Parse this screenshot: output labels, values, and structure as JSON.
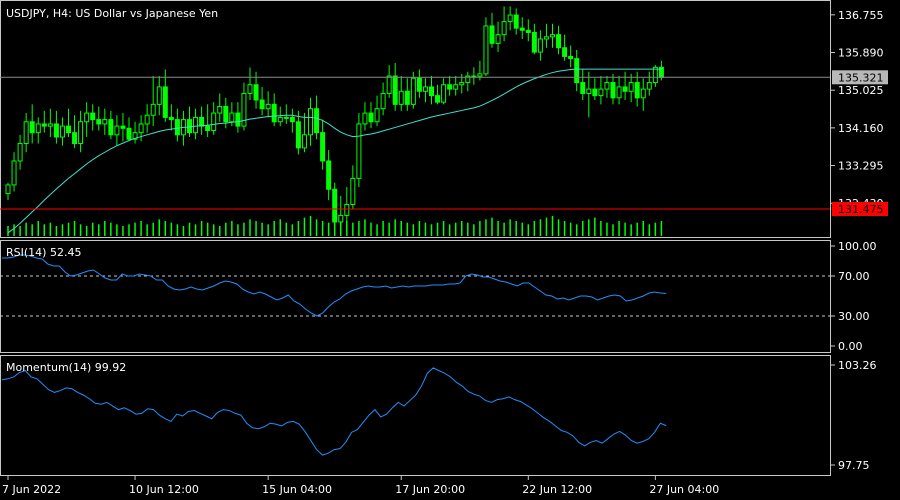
{
  "colors": {
    "background": "#000000",
    "frame": "#c8c8c8",
    "text": "#ffffff",
    "candle": "#00ff00",
    "volume": "#00ff00",
    "ma": "#40e0d0",
    "indicator": "#1e90ff",
    "bid_line": "#8a8a8a",
    "bid_label_bg": "#b8b8b8",
    "bid_label_text": "#000000",
    "level_line": "#ff0000",
    "level_label_bg": "#ff0000",
    "level_label_text": "#000000",
    "guide_line": "#c8c8c8"
  },
  "chart_data": [
    {
      "type": "candlestick",
      "title": "USDJPY, H4:  US Dollar vs Japanese Yen",
      "ylim": [
        131.7,
        137.05
      ],
      "y_ticks": [
        "136.755",
        "135.890",
        "135.025",
        "134.160",
        "133.295",
        "132.430"
      ],
      "x_ticks": [
        {
          "label": "7 Jun 2022",
          "bar": 0
        },
        {
          "label": "10 Jun 12:00",
          "bar": 21
        },
        {
          "label": "15 Jun 04:00",
          "bar": 43
        },
        {
          "label": "17 Jun 20:00",
          "bar": 65
        },
        {
          "label": "22 Jun 12:00",
          "bar": 86
        },
        {
          "label": "27 Jun 04:00",
          "bar": 107
        }
      ],
      "bid_price": "135.321",
      "level_price": "131.475",
      "bars_total": 109,
      "open": [
        132.65,
        132.85,
        133.4,
        133.8,
        134.3,
        134.05,
        134.25,
        134.2,
        134.25,
        133.95,
        134.2,
        134.05,
        133.8,
        134.3,
        134.5,
        134.35,
        134.25,
        134.35,
        134.0,
        134.2,
        134.15,
        133.9,
        134.05,
        134.25,
        134.45,
        134.7,
        135.1,
        134.4,
        134.35,
        134.0,
        134.35,
        134.05,
        134.4,
        134.2,
        134.1,
        134.5,
        134.65,
        134.3,
        134.5,
        134.2,
        134.95,
        135.15,
        134.8,
        134.6,
        134.7,
        134.3,
        134.4,
        134.4,
        134.3,
        133.7,
        134.0,
        134.6,
        134.05,
        133.4,
        132.75,
        132.0,
        132.15,
        132.4,
        133.0,
        134.25,
        134.5,
        134.3,
        134.6,
        134.95,
        135.35,
        134.7,
        135.0,
        134.7,
        135.3,
        135.0,
        135.1,
        134.9,
        134.75,
        135.15,
        135.05,
        135.15,
        135.2,
        135.35,
        135.35,
        135.4,
        136.5,
        136.1,
        136.3,
        136.6,
        136.75,
        136.45,
        136.4,
        136.35,
        135.9,
        136.2,
        136.25,
        136.3,
        136.0,
        135.8,
        135.75,
        135.2,
        134.95,
        135.05,
        134.9,
        135.05,
        135.2,
        134.85,
        135.1,
        135.0,
        135.2,
        134.85,
        135.05,
        135.2,
        135.55
      ],
      "high": [
        132.9,
        133.6,
        134.0,
        134.5,
        134.7,
        134.4,
        134.55,
        134.6,
        134.55,
        134.4,
        134.6,
        134.45,
        134.55,
        134.75,
        134.7,
        134.65,
        134.6,
        134.55,
        134.45,
        134.5,
        134.4,
        134.3,
        134.45,
        134.7,
        135.35,
        135.35,
        135.5,
        134.7,
        134.6,
        134.55,
        134.65,
        134.6,
        134.65,
        134.7,
        134.75,
        134.95,
        134.85,
        134.75,
        134.75,
        135.2,
        135.55,
        135.45,
        135.1,
        135.0,
        134.95,
        134.65,
        134.7,
        134.6,
        134.55,
        134.5,
        134.85,
        134.9,
        134.35,
        133.65,
        132.9,
        132.6,
        132.8,
        133.3,
        134.5,
        134.75,
        134.75,
        134.9,
        135.2,
        135.6,
        135.65,
        135.35,
        135.3,
        135.45,
        135.5,
        135.3,
        135.35,
        135.15,
        135.3,
        135.35,
        135.35,
        135.4,
        135.45,
        135.55,
        135.7,
        136.7,
        136.8,
        136.6,
        136.95,
        136.95,
        136.9,
        136.7,
        136.65,
        136.55,
        136.4,
        136.55,
        136.55,
        136.5,
        136.3,
        136.05,
        135.95,
        135.5,
        135.45,
        135.3,
        135.35,
        135.35,
        135.4,
        135.35,
        135.45,
        135.4,
        135.45,
        135.3,
        135.45,
        135.6,
        135.7
      ],
      "low": [
        132.5,
        132.7,
        133.2,
        133.6,
        133.8,
        133.8,
        134.05,
        133.95,
        133.8,
        133.75,
        133.95,
        133.7,
        133.6,
        133.95,
        134.1,
        134.1,
        134.0,
        133.9,
        133.75,
        133.85,
        133.85,
        133.8,
        133.85,
        134.05,
        134.2,
        134.45,
        134.3,
        134.1,
        133.85,
        133.75,
        133.95,
        133.9,
        134.0,
        133.95,
        134.0,
        134.3,
        134.15,
        134.2,
        134.05,
        134.1,
        134.8,
        134.6,
        134.45,
        134.4,
        134.2,
        134.2,
        134.25,
        134.05,
        133.55,
        133.6,
        133.75,
        133.9,
        133.2,
        132.5,
        131.8,
        131.7,
        131.9,
        132.3,
        132.8,
        134.1,
        134.15,
        134.2,
        134.45,
        134.85,
        134.55,
        134.55,
        134.55,
        134.6,
        134.85,
        134.75,
        134.7,
        134.7,
        134.7,
        134.9,
        134.9,
        134.95,
        135.0,
        135.15,
        135.25,
        135.35,
        136.0,
        135.9,
        136.15,
        136.4,
        136.3,
        136.2,
        136.15,
        135.85,
        135.7,
        136.0,
        136.0,
        135.85,
        135.7,
        135.55,
        135.0,
        134.8,
        134.4,
        134.8,
        134.7,
        134.85,
        134.7,
        134.7,
        134.8,
        134.75,
        134.65,
        134.55,
        134.9,
        135.1,
        135.25
      ],
      "close": [
        132.85,
        133.4,
        133.8,
        134.3,
        134.05,
        134.25,
        134.2,
        134.25,
        133.95,
        134.2,
        134.05,
        133.8,
        134.3,
        134.5,
        134.35,
        134.25,
        134.35,
        134.0,
        134.2,
        134.15,
        133.9,
        134.05,
        134.25,
        134.45,
        134.7,
        135.1,
        134.4,
        134.35,
        134.0,
        134.35,
        134.05,
        134.4,
        134.2,
        134.1,
        134.5,
        134.65,
        134.3,
        134.5,
        134.2,
        134.95,
        135.15,
        134.8,
        134.6,
        134.7,
        134.3,
        134.4,
        134.4,
        134.3,
        133.7,
        134.0,
        134.6,
        134.05,
        133.4,
        132.75,
        132.0,
        132.15,
        132.4,
        133.0,
        134.25,
        134.5,
        134.3,
        134.6,
        134.95,
        135.35,
        134.7,
        135.0,
        134.7,
        135.3,
        135.0,
        135.1,
        134.9,
        134.75,
        135.15,
        135.05,
        135.15,
        135.2,
        135.35,
        135.35,
        135.4,
        136.5,
        136.1,
        136.3,
        136.6,
        136.75,
        136.45,
        136.4,
        136.35,
        135.9,
        136.2,
        136.25,
        136.3,
        136.0,
        135.8,
        135.75,
        135.2,
        134.95,
        135.05,
        134.9,
        135.05,
        135.2,
        134.85,
        135.1,
        135.0,
        135.2,
        134.85,
        135.05,
        135.2,
        135.55,
        135.32
      ],
      "ma": [
        131.75,
        131.85,
        131.97,
        132.1,
        132.23,
        132.36,
        132.5,
        132.63,
        132.76,
        132.88,
        133.0,
        133.11,
        133.22,
        133.33,
        133.43,
        133.52,
        133.6,
        133.68,
        133.75,
        133.81,
        133.87,
        133.92,
        133.96,
        134.0,
        134.04,
        134.08,
        134.11,
        134.13,
        134.15,
        134.17,
        134.18,
        134.2,
        134.21,
        134.22,
        134.24,
        134.26,
        134.27,
        134.29,
        134.3,
        134.33,
        134.36,
        134.38,
        134.4,
        134.42,
        134.43,
        134.44,
        134.45,
        134.45,
        134.42,
        134.4,
        134.4,
        134.38,
        134.33,
        134.25,
        134.15,
        134.06,
        134.0,
        133.96,
        133.97,
        134.0,
        134.02,
        134.05,
        134.09,
        134.13,
        134.17,
        134.21,
        134.25,
        134.29,
        134.33,
        134.37,
        134.41,
        134.44,
        134.47,
        134.5,
        134.53,
        134.56,
        134.59,
        134.62,
        134.66,
        134.72,
        134.79,
        134.86,
        134.94,
        135.02,
        135.1,
        135.17,
        135.23,
        135.29,
        135.34,
        135.39,
        135.43,
        135.46,
        135.48,
        135.5,
        135.51,
        135.51,
        135.51,
        135.51,
        135.51,
        135.51,
        135.51,
        135.51,
        135.51,
        135.51,
        135.51,
        135.51,
        135.51,
        135.51,
        135.51
      ],
      "volume_label": "",
      "volume": [
        6,
        7,
        6,
        8,
        7,
        9,
        7,
        8,
        6,
        7,
        8,
        9,
        7,
        6,
        8,
        7,
        9,
        8,
        7,
        6,
        7,
        8,
        9,
        7,
        8,
        10,
        9,
        8,
        7,
        6,
        8,
        7,
        9,
        8,
        7,
        6,
        8,
        9,
        7,
        8,
        10,
        9,
        8,
        7,
        9,
        10,
        8,
        7,
        9,
        11,
        12,
        10,
        9,
        8,
        10,
        11,
        9,
        8,
        9,
        10,
        8,
        7,
        9,
        8,
        10,
        9,
        8,
        7,
        9,
        8,
        7,
        8,
        9,
        7,
        8,
        9,
        8,
        7,
        9,
        10,
        11,
        9,
        8,
        10,
        9,
        8,
        7,
        9,
        10,
        11,
        12,
        10,
        9,
        8,
        7,
        9,
        10,
        11,
        9,
        8,
        7,
        9,
        8,
        7,
        8,
        9,
        7,
        8,
        9
      ]
    },
    {
      "type": "line",
      "title": "RSI(14) 52.45",
      "ylim": [
        0,
        100
      ],
      "y_ticks": [
        "100.00",
        "70.00",
        "30.00",
        "0.00"
      ],
      "levels": [
        70,
        30
      ],
      "values": [
        88,
        88,
        89,
        91,
        91,
        90,
        88,
        87,
        82,
        80,
        80,
        74,
        70,
        71,
        73,
        75,
        76,
        72,
        68,
        66,
        66,
        72,
        70,
        70,
        72,
        71,
        70,
        66,
        66,
        60,
        57,
        56,
        57,
        59,
        57,
        56,
        58,
        60,
        63,
        65,
        64,
        62,
        57,
        54,
        52,
        54,
        52,
        49,
        46,
        48,
        51,
        45,
        42,
        37,
        33,
        30,
        33,
        39,
        44,
        47,
        52,
        55,
        57,
        59,
        60,
        59,
        59,
        60,
        58,
        59,
        60,
        59,
        60,
        60,
        60,
        61,
        61,
        61,
        62,
        62,
        63,
        70,
        72,
        71,
        69,
        69,
        67,
        65,
        64,
        62,
        60,
        63,
        63,
        59,
        55,
        51,
        50,
        47,
        48,
        46,
        48,
        50,
        50,
        49,
        46,
        48,
        50,
        51,
        50,
        45,
        46,
        48,
        50,
        53,
        54,
        53,
        52.45
      ]
    },
    {
      "type": "line",
      "title": "Momentum(14) 99.92",
      "ylim": [
        97.75,
        103.26
      ],
      "y_ticks": [
        "103.26",
        "97.75"
      ],
      "values": [
        102.45,
        102.5,
        102.6,
        102.85,
        102.95,
        102.6,
        102.5,
        102.2,
        101.9,
        101.75,
        101.85,
        102.0,
        101.95,
        101.75,
        101.6,
        101.4,
        101.15,
        101.1,
        101.2,
        101.0,
        100.8,
        100.9,
        100.75,
        100.55,
        100.6,
        100.85,
        100.8,
        100.5,
        100.3,
        100.15,
        100.55,
        100.45,
        100.7,
        100.75,
        100.6,
        100.45,
        100.3,
        100.65,
        100.8,
        100.75,
        100.6,
        100.5,
        100.05,
        99.8,
        99.75,
        99.85,
        100.05,
        100.0,
        99.9,
        100.1,
        100.15,
        100.0,
        99.6,
        99.1,
        98.6,
        98.3,
        98.4,
        98.6,
        98.65,
        99.0,
        99.55,
        99.7,
        100.1,
        100.5,
        100.8,
        100.4,
        100.55,
        100.9,
        101.2,
        101.0,
        101.3,
        101.6,
        102.1,
        102.8,
        103.1,
        102.95,
        102.8,
        102.6,
        102.3,
        102.1,
        101.8,
        101.65,
        101.55,
        101.3,
        101.2,
        101.35,
        101.4,
        101.5,
        101.35,
        101.25,
        101.05,
        100.85,
        100.6,
        100.35,
        100.15,
        99.9,
        99.65,
        99.55,
        99.35,
        99.0,
        98.8,
        99.0,
        99.1,
        98.95,
        99.2,
        99.45,
        99.6,
        99.4,
        99.1,
        98.95,
        99.05,
        99.2,
        99.55,
        100.05,
        99.92
      ]
    }
  ]
}
